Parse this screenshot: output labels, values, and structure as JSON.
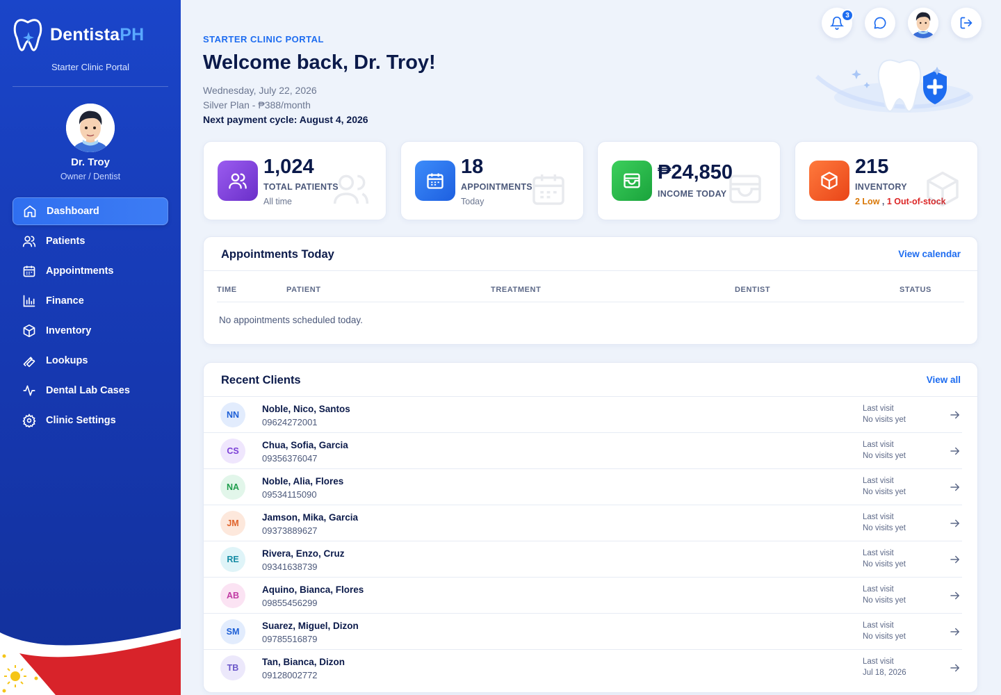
{
  "sidebar": {
    "brand_main": "Dentista",
    "brand_accent": "PH",
    "portal_label": "Starter Clinic Portal",
    "user_name": "Dr. Troy",
    "user_role": "Owner / Dentist",
    "nav": [
      {
        "label": "Dashboard",
        "icon": "home-icon",
        "active": true
      },
      {
        "label": "Patients",
        "icon": "users-icon"
      },
      {
        "label": "Appointments",
        "icon": "calendar-icon"
      },
      {
        "label": "Finance",
        "icon": "bar-chart-icon"
      },
      {
        "label": "Inventory",
        "icon": "box-icon"
      },
      {
        "label": "Lookups",
        "icon": "wrench-icon"
      },
      {
        "label": "Dental Lab Cases",
        "icon": "activity-icon"
      },
      {
        "label": "Clinic Settings",
        "icon": "gear-icon"
      }
    ]
  },
  "header": {
    "eyebrow": "STARTER CLINIC PORTAL",
    "welcome": "Welcome back, Dr. Troy!",
    "date": "Wednesday, July 22, 2026",
    "plan": "Silver Plan - ₱388/month",
    "next_payment": "Next payment cycle: August 4, 2026",
    "notification_count": "3"
  },
  "stats": {
    "patients": {
      "value": "1,024",
      "label": "TOTAL PATIENTS",
      "sub": "All time"
    },
    "appointments": {
      "value": "18",
      "label": "APPOINTMENTS",
      "sub": "Today"
    },
    "income": {
      "value": "₱24,850",
      "label": "INCOME TODAY"
    },
    "inventory": {
      "value": "215",
      "label": "INVENTORY",
      "low": "2 Low",
      "comma": ",",
      "out": "1 Out-of-stock"
    }
  },
  "appointments_panel": {
    "title": "Appointments Today",
    "link": "View calendar",
    "columns": [
      "TIME",
      "PATIENT",
      "TREATMENT",
      "DENTIST",
      "STATUS"
    ],
    "empty_text": "No appointments scheduled today."
  },
  "clients_panel": {
    "title": "Recent Clients",
    "link": "View all",
    "last_visit_label": "Last visit",
    "rows": [
      {
        "initials": "NN",
        "name": "Noble, Nico, Santos",
        "phone": "09624272001",
        "last_visit": "No visits yet"
      },
      {
        "initials": "CS",
        "name": "Chua, Sofia, Garcia",
        "phone": "09356376047",
        "last_visit": "No visits yet"
      },
      {
        "initials": "NA",
        "name": "Noble, Alia, Flores",
        "phone": "09534115090",
        "last_visit": "No visits yet"
      },
      {
        "initials": "JM",
        "name": "Jamson, Mika, Garcia",
        "phone": "09373889627",
        "last_visit": "No visits yet"
      },
      {
        "initials": "RE",
        "name": "Rivera, Enzo, Cruz",
        "phone": "09341638739",
        "last_visit": "No visits yet"
      },
      {
        "initials": "AB",
        "name": "Aquino, Bianca, Flores",
        "phone": "09855456299",
        "last_visit": "No visits yet"
      },
      {
        "initials": "SM",
        "name": "Suarez, Miguel, Dizon",
        "phone": "09785516879",
        "last_visit": "No visits yet"
      },
      {
        "initials": "TB",
        "name": "Tan, Bianca, Dizon",
        "phone": "09128002772",
        "last_visit": "Jul 18, 2026"
      }
    ]
  },
  "colors": {
    "primary": "#1d6cf0",
    "sidebar": "#1a45c9",
    "warning": "#d97706",
    "danger": "#dc2626",
    "patients_icon": "#7b3fd6",
    "appointments_icon": "#2f7cf6",
    "income_icon": "#22b14c",
    "inventory_icon": "#f25c2a"
  }
}
